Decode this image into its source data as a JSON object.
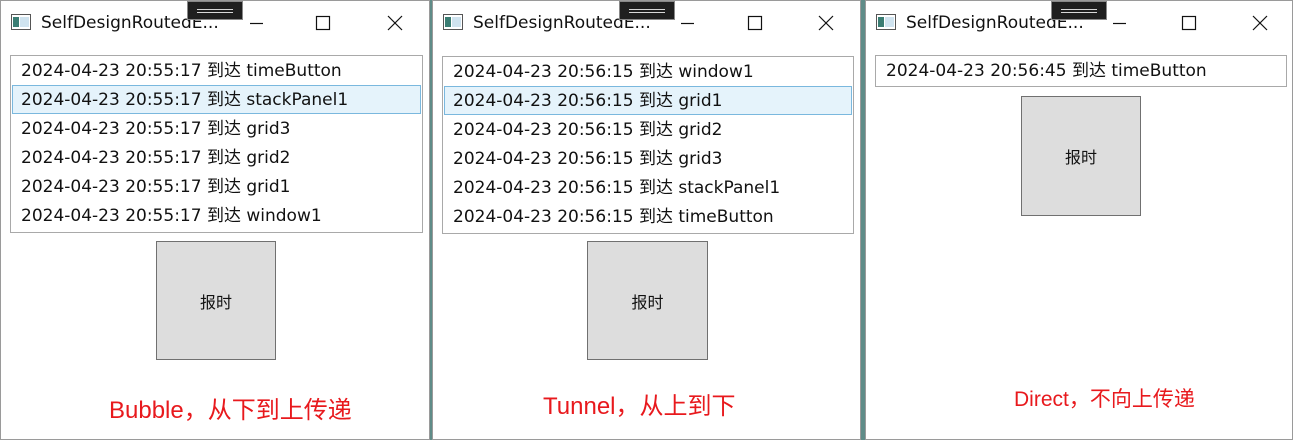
{
  "colors": {
    "caption": "#e8191d",
    "selection": "#e5f3fb",
    "selection_border": "#7ab8de",
    "button": "#dddddd"
  },
  "windows": [
    {
      "title": "SelfDesignRoutedE...",
      "items": [
        "2024-04-23 20:55:17 到达 timeButton",
        "2024-04-23 20:55:17 到达 stackPanel1",
        "2024-04-23 20:55:17 到达 grid3",
        "2024-04-23 20:55:17 到达 grid2",
        "2024-04-23 20:55:17 到达 grid1",
        "2024-04-23 20:55:17 到达 window1"
      ],
      "selected_index": 1,
      "button_label": "报时",
      "caption": "Bubble，从下到上传递"
    },
    {
      "title": "SelfDesignRoutedE...",
      "items": [
        "2024-04-23 20:56:15 到达 window1",
        "2024-04-23 20:56:15 到达 grid1",
        "2024-04-23 20:56:15 到达 grid2",
        "2024-04-23 20:56:15 到达 grid3",
        "2024-04-23 20:56:15 到达 stackPanel1",
        "2024-04-23 20:56:15 到达 timeButton"
      ],
      "selected_index": 1,
      "button_label": "报时",
      "caption": "Tunnel，从上到下"
    },
    {
      "title": "SelfDesignRoutedE...",
      "items": [
        "2024-04-23 20:56:45 到达 timeButton"
      ],
      "selected_index": -1,
      "button_label": "报时",
      "caption": "Direct，不向上传递"
    }
  ],
  "icons": {
    "app": "window-app-icon",
    "minimize": "minimize-icon",
    "maximize": "maximize-icon",
    "close": "close-icon"
  }
}
